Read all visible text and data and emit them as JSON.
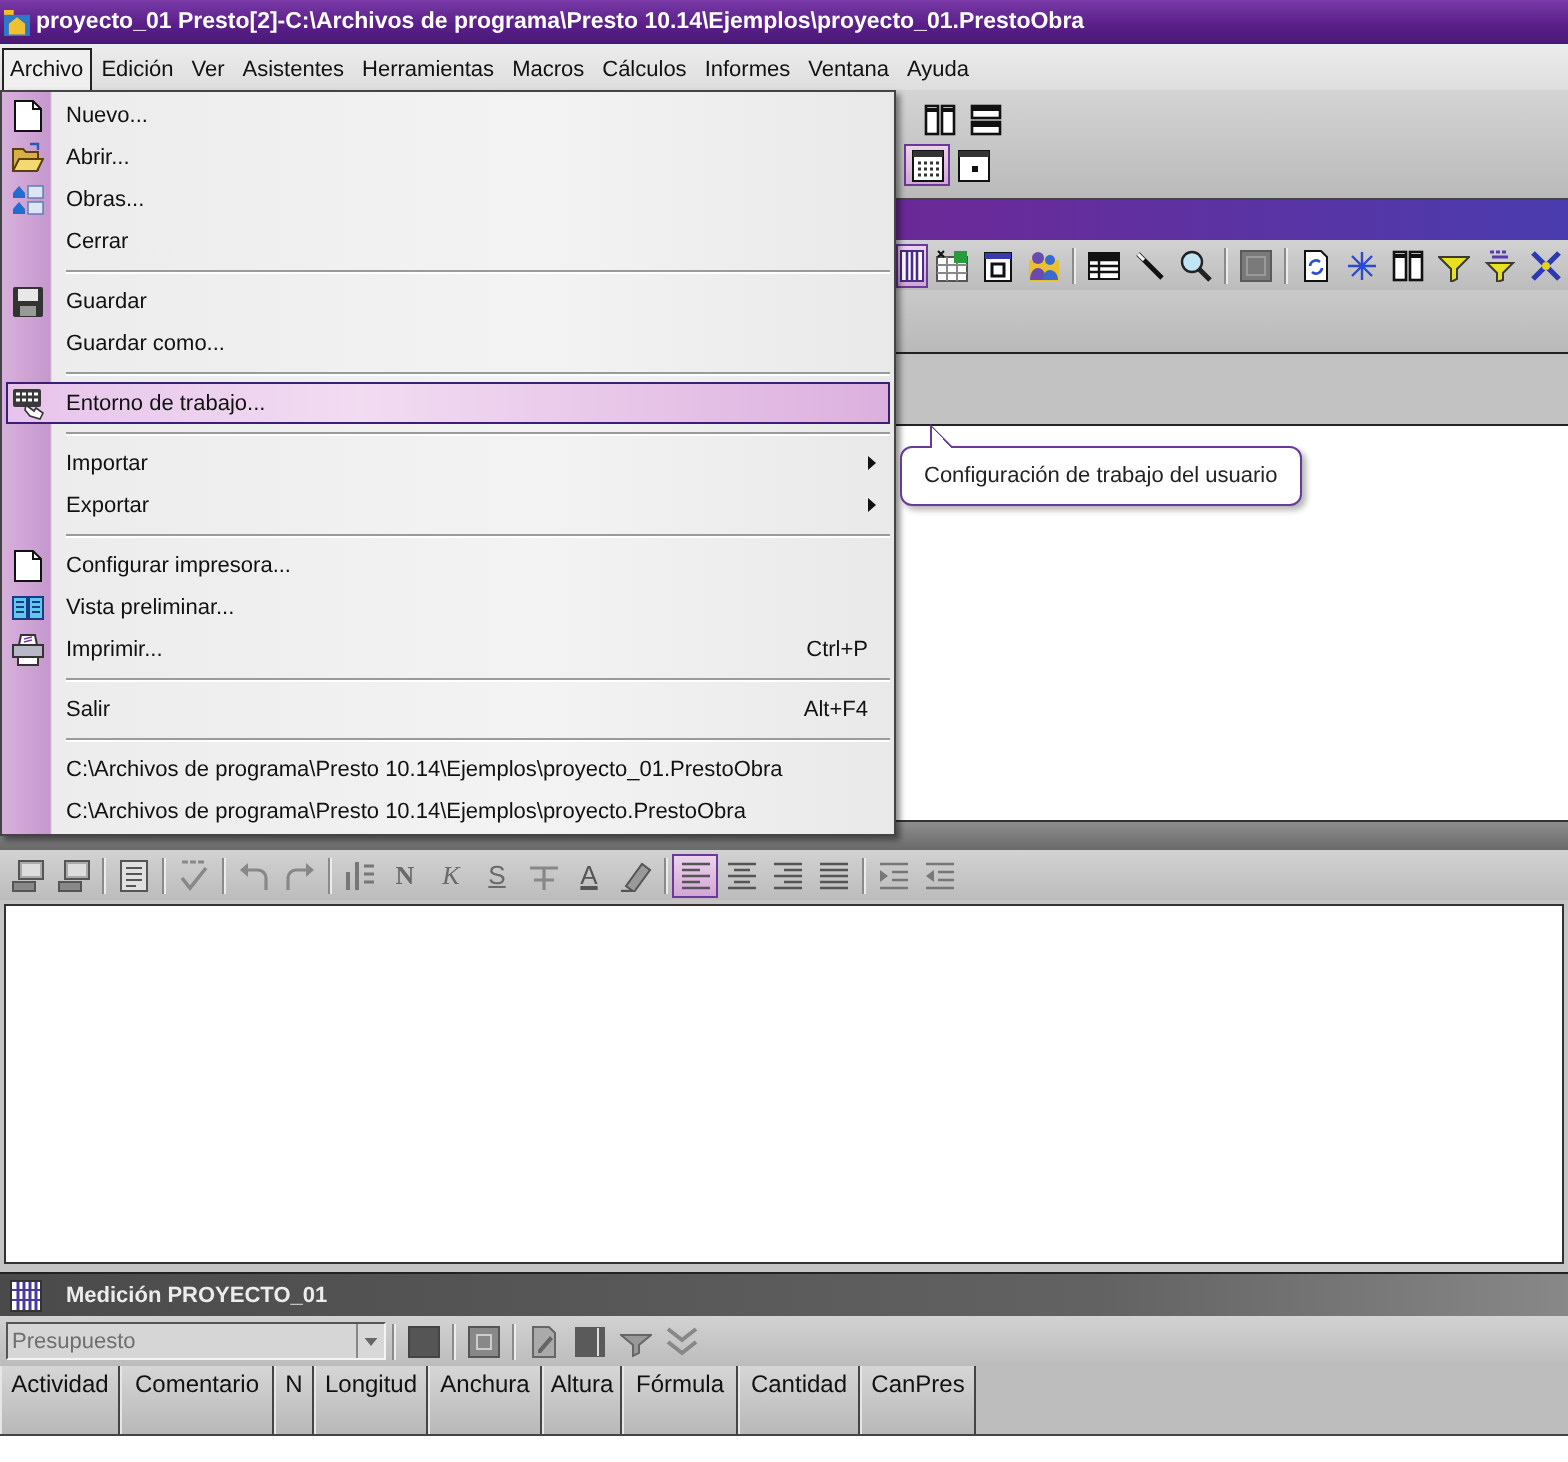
{
  "window": {
    "title": "proyecto_01 Presto[2]-C:\\Archivos de programa\\Presto 10.14\\Ejemplos\\proyecto_01.PrestoObra"
  },
  "menu_bar": [
    {
      "label": "Archivo",
      "selected": true
    },
    {
      "label": "Edición",
      "selected": false
    },
    {
      "label": "Ver",
      "selected": false
    },
    {
      "label": "Asistentes",
      "selected": false
    },
    {
      "label": "Herramientas",
      "selected": false
    },
    {
      "label": "Macros",
      "selected": false
    },
    {
      "label": "Cálculos",
      "selected": false
    },
    {
      "label": "Informes",
      "selected": false
    },
    {
      "label": "Ventana",
      "selected": false
    },
    {
      "label": "Ayuda",
      "selected": false
    }
  ],
  "file_menu": {
    "items": [
      {
        "kind": "command",
        "label": "Nuevo...",
        "selected": false
      },
      {
        "kind": "command",
        "label": "Abrir...",
        "selected": false
      },
      {
        "kind": "command",
        "label": "Obras...",
        "selected": false
      },
      {
        "kind": "command",
        "label": "Cerrar",
        "selected": false
      },
      {
        "kind": "separator"
      },
      {
        "kind": "command",
        "label": "Guardar",
        "selected": false
      },
      {
        "kind": "command",
        "label": "Guardar como...",
        "selected": false
      },
      {
        "kind": "separator"
      },
      {
        "kind": "command",
        "label": "Entorno de trabajo...",
        "selected": true
      },
      {
        "kind": "separator"
      },
      {
        "kind": "submenu",
        "label": "Importar",
        "selected": false
      },
      {
        "kind": "submenu",
        "label": "Exportar",
        "selected": false
      },
      {
        "kind": "separator"
      },
      {
        "kind": "command",
        "label": "Configurar impresora...",
        "selected": false
      },
      {
        "kind": "command",
        "label": "Vista preliminar...",
        "selected": false
      },
      {
        "kind": "command",
        "label": "Imprimir...",
        "shortcut": "Ctrl+P",
        "selected": false
      },
      {
        "kind": "separator"
      },
      {
        "kind": "command",
        "label": "Salir",
        "shortcut": "Alt+F4",
        "selected": false
      },
      {
        "kind": "separator"
      },
      {
        "kind": "command",
        "label": "C:\\Archivos de programa\\Presto 10.14\\Ejemplos\\proyecto_01.PrestoObra",
        "selected": false
      },
      {
        "kind": "command",
        "label": "C:\\Archivos de programa\\Presto 10.14\\Ejemplos\\proyecto.PrestoObra",
        "selected": false
      }
    ]
  },
  "layout_toolbar": {
    "buttons": [
      {
        "on": false
      },
      {
        "on": false
      },
      {
        "on": true
      },
      {
        "on": false
      }
    ]
  },
  "work_toolbar": {
    "buttons": [
      {
        "on": true
      },
      {
        "on": false
      },
      {
        "on": false
      },
      {
        "on": false
      },
      {
        "on": false
      },
      {
        "on": false
      },
      {
        "on": false
      },
      {
        "on": false
      },
      {
        "on": false
      },
      {
        "on": false
      },
      {
        "on": false
      },
      {
        "on": false
      },
      {
        "on": false
      },
      {
        "on": false
      }
    ]
  },
  "tooltip": {
    "text": "Configuración de trabajo del usuario"
  },
  "text_toolbar": {
    "buttons": [
      {
        "on": false
      },
      {
        "on": false
      },
      {
        "on": false
      },
      {
        "on": false
      },
      {
        "on": false
      },
      {
        "on": false
      },
      {
        "on": false
      },
      {
        "glyph": "N",
        "on": false
      },
      {
        "glyph": "K",
        "on": false
      },
      {
        "glyph": "S",
        "on": false
      },
      {
        "on": false
      },
      {
        "glyph": "A",
        "on": false
      },
      {
        "on": false
      },
      {
        "on": true
      },
      {
        "on": false
      },
      {
        "on": false
      },
      {
        "on": false
      },
      {
        "on": false
      },
      {
        "on": false
      }
    ]
  },
  "medicion_panel": {
    "title": "Medición PROYECTO_01",
    "selector": {
      "value": "Presupuesto",
      "disabled": true
    },
    "columns": [
      "Actividad",
      "Comentario",
      "N",
      "Longitud",
      "Anchura",
      "Altura",
      "Fórmula",
      "Cantidad",
      "CanPres"
    ]
  }
}
